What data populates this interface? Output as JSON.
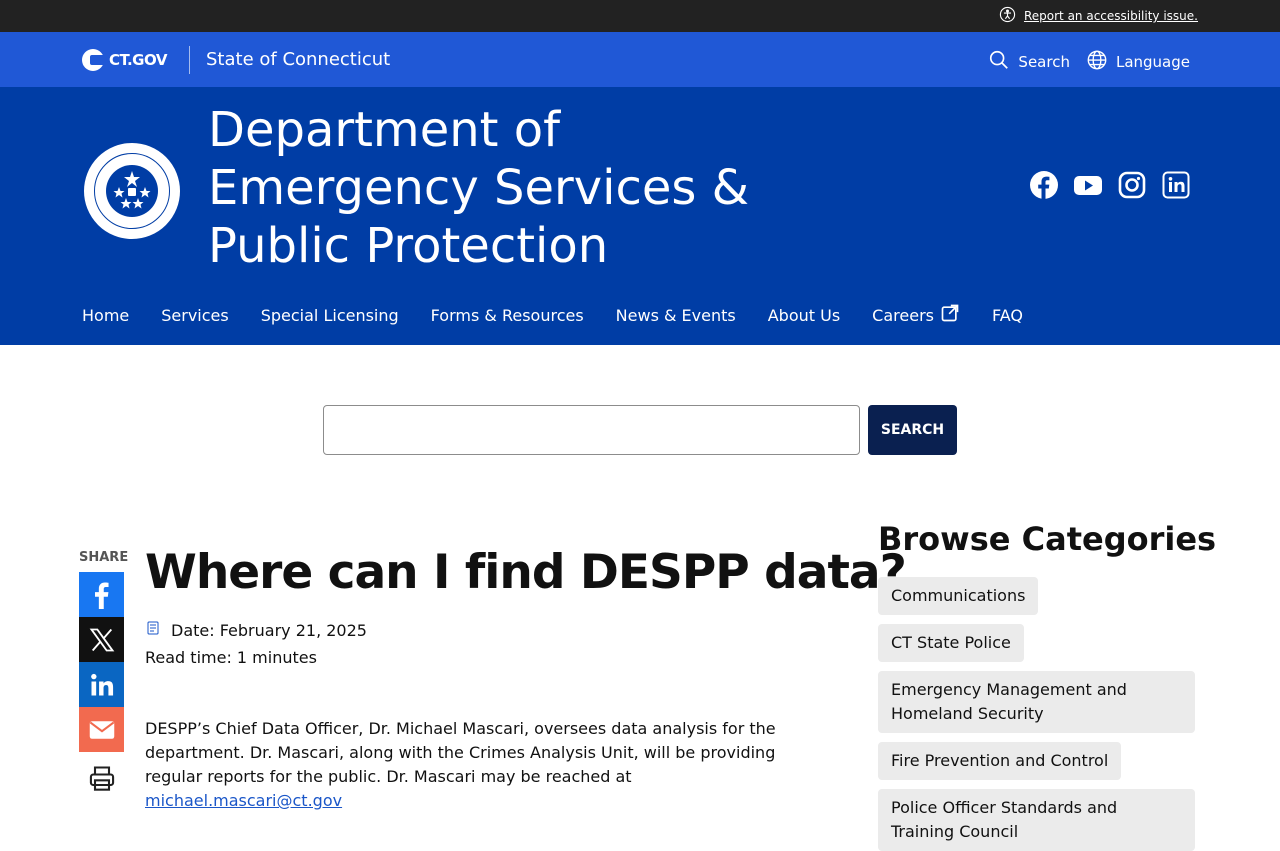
{
  "utility": {
    "accessibility_link": "Report an accessibility issue."
  },
  "ctbar": {
    "logo_text": "CT.GOV",
    "state_name": "State of Connecticut",
    "search_label": "Search",
    "language_label": "Language"
  },
  "agency": {
    "title_line1": "Department of",
    "title_line2": "Emergency Services &",
    "title_line3": "Public Protection",
    "social_icons": [
      "facebook-icon",
      "youtube-icon",
      "instagram-icon",
      "linkedin-icon"
    ]
  },
  "nav": {
    "items": [
      {
        "label": "Home"
      },
      {
        "label": "Services"
      },
      {
        "label": "Special Licensing"
      },
      {
        "label": "Forms & Resources"
      },
      {
        "label": "News & Events"
      },
      {
        "label": "About Us"
      },
      {
        "label": "Careers"
      },
      {
        "label": "FAQ"
      }
    ]
  },
  "search": {
    "value": "",
    "button_label": "SEARCH"
  },
  "share": {
    "label": "SHARE"
  },
  "article": {
    "title": "Where can I find DESPP data?",
    "date": "Date: February 21, 2025",
    "read_time": "Read time: 1 minutes",
    "body_text": "DESPP’s Chief Data Officer, Dr. Michael Mascari, oversees data analysis for the department. Dr. Mascari, along with the Crimes Analysis Unit, will be providing regular reports for the public. Dr. Mascari may be reached at",
    "email": "michael.mascari@ct.gov"
  },
  "sidebar": {
    "title": "Browse Categories",
    "categories": [
      {
        "label": "Communications"
      },
      {
        "label": "CT State Police"
      },
      {
        "label": "Emergency Management and Homeland Security"
      },
      {
        "label": "Fire Prevention and Control"
      },
      {
        "label": "Police Officer Standards and Training Council"
      }
    ]
  },
  "colors": {
    "util_bar": "#222222",
    "ct_bar": "#2058d6",
    "agency_bg": "#003da5",
    "search_button": "#0a2050",
    "category_bg": "#ebebeb"
  }
}
